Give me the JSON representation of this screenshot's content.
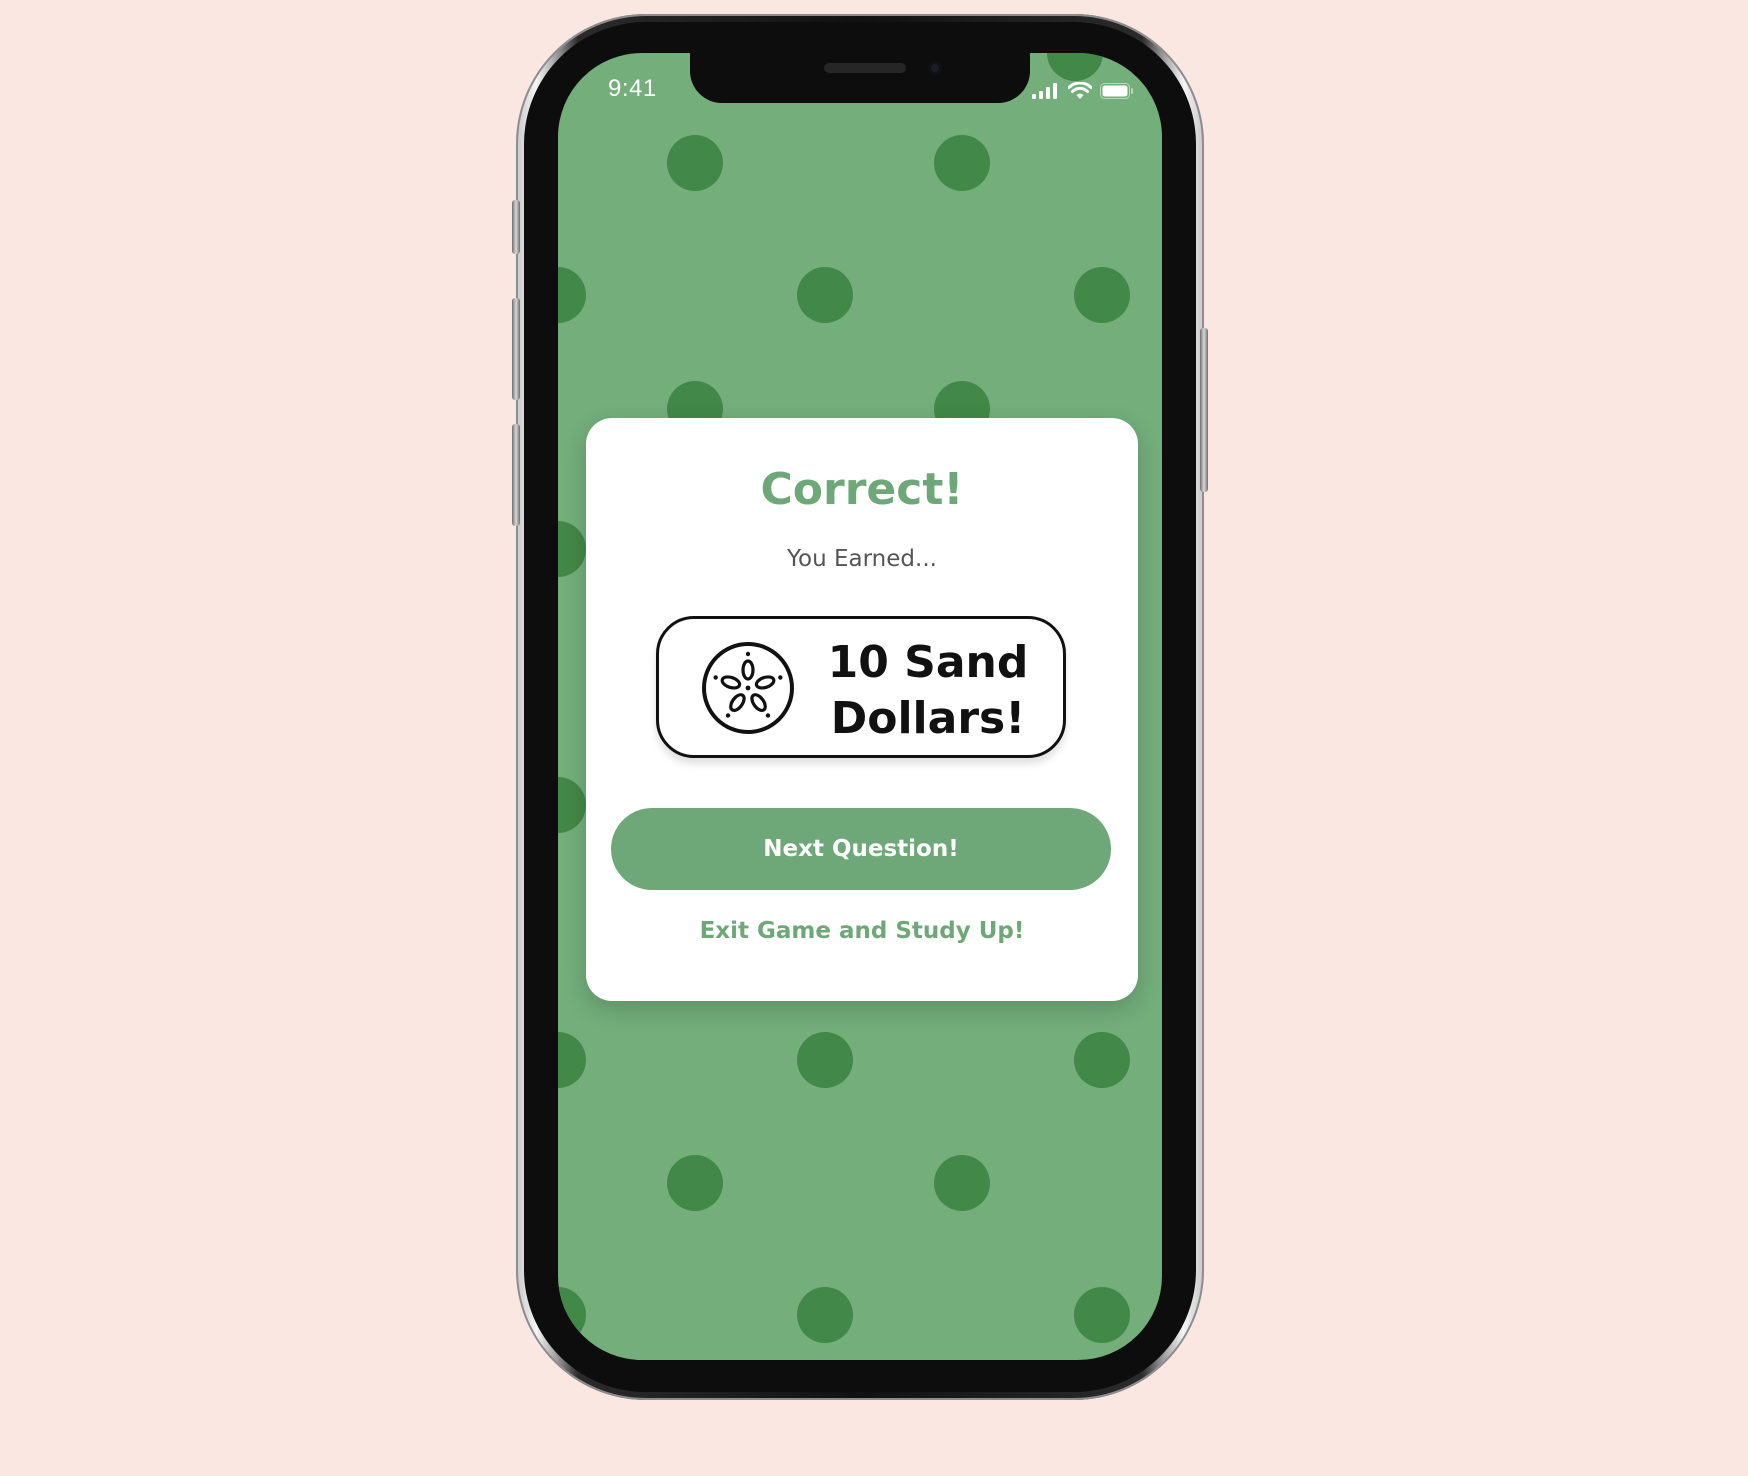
{
  "status_bar": {
    "time": "9:41",
    "icons": [
      "signal-icon",
      "wifi-icon",
      "battery-icon"
    ]
  },
  "modal": {
    "title": "Correct!",
    "subtitle": "You Earned...",
    "reward": {
      "icon": "sand-dollar-icon",
      "line1": "10 Sand",
      "line2": "Dollars!"
    },
    "primary_button": "Next Question!",
    "secondary_link": "Exit Game and Study Up!"
  },
  "colors": {
    "page_background": "#fbe7e1",
    "screen_background": "#73ae7b",
    "dot": "#428848",
    "accent": "#6ea878",
    "card": "#ffffff",
    "text_dark": "#111111",
    "text_muted": "#555555"
  }
}
